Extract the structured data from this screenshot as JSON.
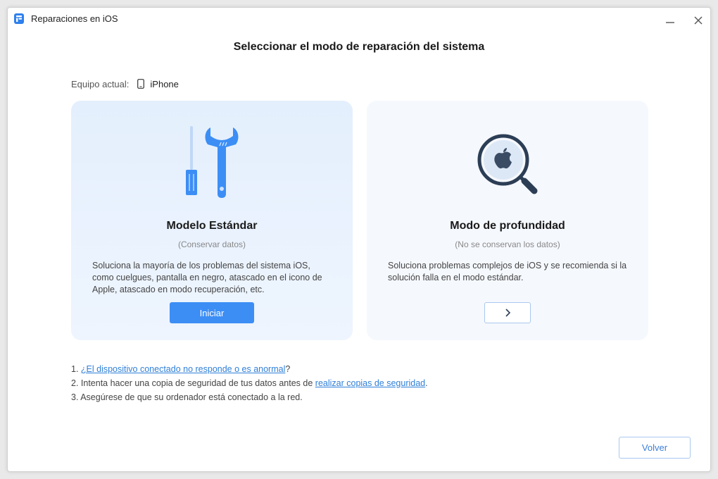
{
  "window": {
    "title": "Reparaciones en iOS"
  },
  "page": {
    "title": "Seleccionar el modo de reparación del sistema"
  },
  "device": {
    "label": "Equipo actual:",
    "name": "iPhone",
    "icon": "phone-icon"
  },
  "modes": {
    "standard": {
      "title": "Modelo Estándar",
      "subtitle": "(Conservar datos)",
      "description": "Soluciona la mayoría de los problemas del sistema iOS, como cuelgues, pantalla en negro, atascado en el icono de Apple, atascado en modo recuperación, etc.",
      "button_label": "Iniciar",
      "icon": "tools-icon"
    },
    "deep": {
      "title": "Modo de profundidad",
      "subtitle": "(No se conservan los datos)",
      "description": "Soluciona problemas complejos de iOS y se recomienda si la solución falla en el modo estándar.",
      "button_icon": "chevron-right-icon",
      "icon": "magnifier-apple-icon"
    }
  },
  "notes": {
    "item1": {
      "prefix": "1. ",
      "link": "¿El dispositivo conectado no responde o es anormal",
      "suffix": "?"
    },
    "item2": {
      "prefix": "2. Intenta hacer una copia de seguridad de tus datos antes de ",
      "link": "realizar copias de seguridad",
      "suffix": "."
    },
    "item3": {
      "text": "3. Asegúrese de que su ordenador está conectado a la red."
    }
  },
  "footer": {
    "back_label": "Volver"
  },
  "colors": {
    "accent": "#3c8ef5",
    "link": "#2f7fd8",
    "card_standard_bg": "#e4effd",
    "card_deep_bg": "#f5f8fd",
    "icon_dark": "#2c3e55"
  }
}
